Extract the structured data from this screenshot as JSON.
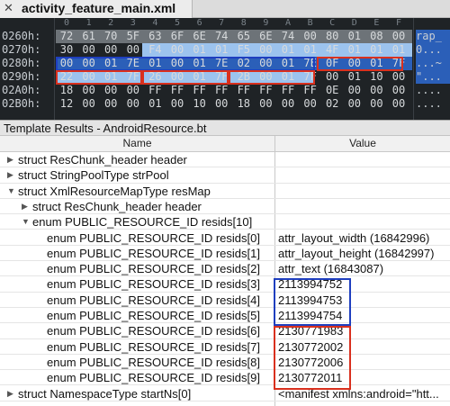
{
  "tab": {
    "title": "activity_feature_main.xml",
    "close_glyph": "✕"
  },
  "hex": {
    "header": [
      "0",
      "1",
      "2",
      "3",
      "4",
      "5",
      "6",
      "7",
      "8",
      "9",
      "A",
      "B",
      "C",
      "D",
      "E",
      "F"
    ],
    "rows": [
      {
        "addr": "0260h:",
        "bytes": [
          "72",
          "61",
          "70",
          "5F",
          "63",
          "6F",
          "6E",
          "74",
          "65",
          "6E",
          "74",
          "00",
          "80",
          "01",
          "08",
          "00"
        ],
        "ascii": "rap_"
      },
      {
        "addr": "0270h:",
        "bytes": [
          "30",
          "00",
          "00",
          "00",
          "F4",
          "00",
          "01",
          "01",
          "F5",
          "00",
          "01",
          "01",
          "4F",
          "01",
          "01",
          "01"
        ],
        "ascii": "0..."
      },
      {
        "addr": "0280h:",
        "bytes": [
          "00",
          "00",
          "01",
          "7E",
          "01",
          "00",
          "01",
          "7E",
          "02",
          "00",
          "01",
          "7E",
          "0F",
          "00",
          "01",
          "7F"
        ],
        "ascii": "...~"
      },
      {
        "addr": "0290h:",
        "bytes": [
          "22",
          "00",
          "01",
          "7F",
          "26",
          "00",
          "01",
          "7F",
          "2B",
          "00",
          "01",
          "7F",
          "00",
          "01",
          "10",
          "00"
        ],
        "ascii": "\"..."
      },
      {
        "addr": "02A0h:",
        "bytes": [
          "18",
          "00",
          "00",
          "00",
          "FF",
          "FF",
          "FF",
          "FF",
          "FF",
          "FF",
          "FF",
          "FF",
          "0E",
          "00",
          "00",
          "00"
        ],
        "ascii": "...."
      },
      {
        "addr": "02B0h:",
        "bytes": [
          "12",
          "00",
          "00",
          "00",
          "01",
          "00",
          "10",
          "00",
          "18",
          "00",
          "00",
          "00",
          "02",
          "00",
          "00",
          "00"
        ],
        "ascii": "...."
      }
    ]
  },
  "template": {
    "panel_title": "Template Results - AndroidResource.bt",
    "col_name": "Name",
    "col_value": "Value",
    "rows": [
      {
        "name": "struct ResChunk_header header",
        "value": "",
        "indent": 0,
        "tri": "▶"
      },
      {
        "name": "struct StringPoolType strPool",
        "value": "",
        "indent": 0,
        "tri": "▶"
      },
      {
        "name": "struct XmlResourceMapType resMap",
        "value": "",
        "indent": 0,
        "tri": "▼"
      },
      {
        "name": "struct ResChunk_header header",
        "value": "",
        "indent": 1,
        "tri": "▶"
      },
      {
        "name": "enum PUBLIC_RESOURCE_ID resids[10]",
        "value": "",
        "indent": 1,
        "tri": "▼"
      },
      {
        "name": "enum PUBLIC_RESOURCE_ID resids[0]",
        "value": "attr_layout_width (16842996)",
        "indent": 2,
        "tri": ""
      },
      {
        "name": "enum PUBLIC_RESOURCE_ID resids[1]",
        "value": "attr_layout_height (16842997)",
        "indent": 2,
        "tri": ""
      },
      {
        "name": "enum PUBLIC_RESOURCE_ID resids[2]",
        "value": "attr_text (16843087)",
        "indent": 2,
        "tri": ""
      },
      {
        "name": "enum PUBLIC_RESOURCE_ID resids[3]",
        "value": "2113994752",
        "indent": 2,
        "tri": ""
      },
      {
        "name": "enum PUBLIC_RESOURCE_ID resids[4]",
        "value": "2113994753",
        "indent": 2,
        "tri": ""
      },
      {
        "name": "enum PUBLIC_RESOURCE_ID resids[5]",
        "value": "2113994754",
        "indent": 2,
        "tri": ""
      },
      {
        "name": "enum PUBLIC_RESOURCE_ID resids[6]",
        "value": "2130771983",
        "indent": 2,
        "tri": ""
      },
      {
        "name": "enum PUBLIC_RESOURCE_ID resids[7]",
        "value": "2130772002",
        "indent": 2,
        "tri": ""
      },
      {
        "name": "enum PUBLIC_RESOURCE_ID resids[8]",
        "value": "2130772006",
        "indent": 2,
        "tri": ""
      },
      {
        "name": "enum PUBLIC_RESOURCE_ID resids[9]",
        "value": "2130772011",
        "indent": 2,
        "tri": ""
      },
      {
        "name": "struct NamespaceType startNs[0]",
        "value": "<manifest xmlns:android=\"htt...",
        "indent": 0,
        "tri": "▶"
      }
    ]
  },
  "colors": {
    "hex_bg": "#1f2326",
    "highlight_blue": "#2b5fb8",
    "highlight_light_blue": "#9cc3ee",
    "annotation_blue": "#1f3fbf",
    "annotation_red": "#d9301e"
  }
}
